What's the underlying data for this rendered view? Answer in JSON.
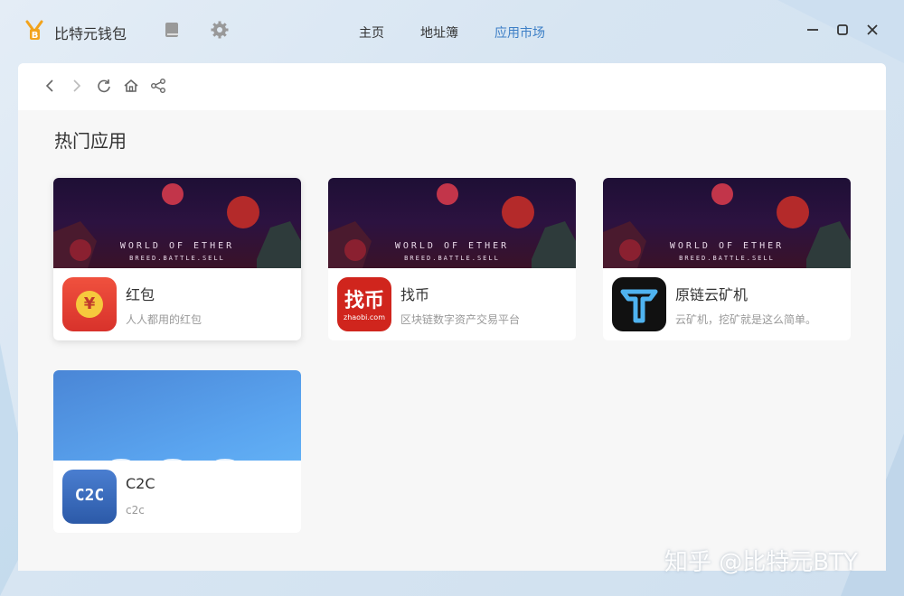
{
  "app": {
    "title": "比特元钱包",
    "accent_color": "#3d7fc6",
    "logo_icon": "bitcoin-logo-icon"
  },
  "nav": {
    "home_label": "主页",
    "address_book_label": "地址簿",
    "market_label": "应用市场",
    "active": "应用市场"
  },
  "toolbar": {
    "icons": [
      "back-icon",
      "forward-icon",
      "refresh-icon",
      "home-icon",
      "share-icon"
    ]
  },
  "hot_apps": {
    "section_title": "热门应用",
    "apps": [
      {
        "name": "红包",
        "desc": "人人都用的红包",
        "icon": "red-packet-icon",
        "icon_glyph": "¥",
        "banner_line1": "WORLD OF ETHER",
        "banner_line2": "BREED.BATTLE.SELL"
      },
      {
        "name": "找币",
        "desc": "区块链数字资产交易平台",
        "icon": "zhaobi-icon",
        "icon_text_1": "找币",
        "icon_text_2": "zhaobi.com",
        "banner_line1": "WORLD OF ETHER",
        "banner_line2": "BREED.BATTLE.SELL"
      },
      {
        "name": "原链云矿机",
        "desc": "云矿机，挖矿就是这么简单。",
        "icon": "cloud-miner-icon",
        "banner_line1": "WORLD OF ETHER",
        "banner_line2": "BREED.BATTLE.SELL"
      },
      {
        "name": "C2C",
        "desc": "c2c",
        "icon": "c2c-icon",
        "icon_text": "C2C"
      }
    ]
  },
  "watermark": "知乎 @比特元BTY"
}
